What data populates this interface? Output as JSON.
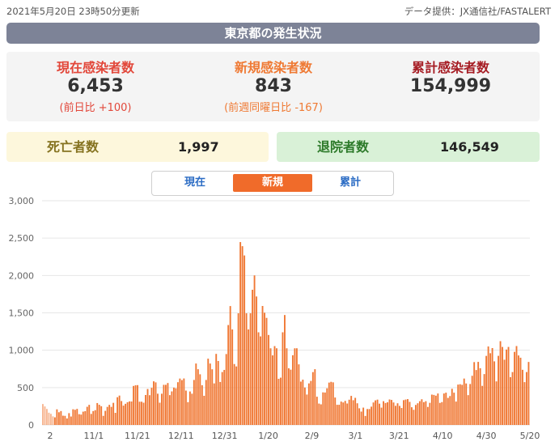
{
  "header": {
    "updated": "2021年5月20日 23時50分更新",
    "source": "データ提供：JX通信社/FASTALERT",
    "title": "東京都の発生状況"
  },
  "stats": {
    "current": {
      "label": "現在感染者数",
      "value": "6,453",
      "sub": "(前日比 +100)"
    },
    "new": {
      "label": "新規感染者数",
      "value": "843",
      "sub": "(前週同曜日比 -167)"
    },
    "total": {
      "label": "累計感染者数",
      "value": "154,999"
    }
  },
  "deaths": {
    "label": "死亡者数",
    "value": "1,997"
  },
  "recovered": {
    "label": "退院者数",
    "value": "146,549"
  },
  "tabs": {
    "current": "現在",
    "new": "新規",
    "total": "累計",
    "active": "new"
  },
  "colors": {
    "bar": "#f07834",
    "accent": "#f06b2a",
    "grid": "#e6e6e6"
  },
  "chart_data": {
    "type": "bar",
    "ylim": [
      0,
      3000
    ],
    "yticks": [
      "3,000",
      "2,500",
      "2,000",
      "1,500",
      "1,000",
      "500",
      "0"
    ],
    "xticks": [
      "2",
      "11/1",
      "11/21",
      "12/11",
      "12/31",
      "1/20",
      "2/9",
      "3/1",
      "3/21",
      "4/10",
      "4/30",
      "5/20"
    ],
    "series": [
      {
        "values": [
          280,
          248,
          214,
          164,
          149,
          115,
          102,
          209,
          170,
          186,
          124,
          122,
          87,
          158,
          113,
          210,
          203,
          215,
          144,
          139,
          178,
          185,
          243,
          269,
          148,
          186,
          198,
          293,
          270,
          251,
          122,
          189,
          242,
          269,
          242,
          296,
          162,
          371,
          393,
          320,
          259,
          283,
          304,
          315,
          314,
          522,
          531,
          533,
          311,
          311,
          298,
          401,
          481,
          398,
          497,
          584,
          570,
          418,
          298,
          418,
          537,
          537,
          561,
          399,
          449,
          500,
          491,
          572,
          621,
          600,
          622,
          460,
          305,
          448,
          418,
          602,
          822,
          746,
          678,
          532,
          390,
          602,
          887,
          822,
          745,
          556,
          951,
          856,
          575,
          708,
          736,
          949,
          1337,
          1591,
          1278,
          815,
          783,
          1494,
          2447,
          2392,
          2268,
          1494,
          1278,
          1494,
          1809,
          2001,
          1719,
          1240,
          1185,
          1592,
          1502,
          1433,
          1204,
          1026,
          931,
          1055,
          1026,
          618,
          633,
          1240,
          1471,
          1026,
          758,
          740,
          933,
          1026,
          1026,
          811,
          580,
          606,
          501,
          407,
          556,
          589,
          707,
          746,
          378,
          286,
          276,
          436,
          434,
          491,
          567,
          577,
          570,
          367,
          270,
          270,
          313,
          301,
          322,
          287,
          338,
          389,
          331,
          363,
          290,
          223,
          179,
          232,
          121,
          213,
          213,
          245,
          301,
          329,
          339,
          285,
          232,
          318,
          294,
          303,
          341,
          335,
          301,
          256,
          290,
          255,
          227,
          332,
          340,
          346,
          309,
          237,
          203,
          268,
          290,
          318,
          344,
          305,
          318,
          241,
          296,
          406,
          402,
          392,
          421,
          295,
          306,
          421,
          432,
          362,
          387,
          484,
          432,
          313,
          540,
          545,
          537,
          621,
          555,
          399,
          548,
          658,
          841,
          735,
          844,
          759,
          523,
          681,
          924,
          1050,
          960,
          1029,
          851,
          583,
          925,
          1121,
          1044,
          873,
          1009,
          1044,
          640,
          708,
          978,
          1056,
          930,
          900,
          738,
          573,
          708,
          843
        ],
        "color": "#f07834"
      }
    ]
  }
}
